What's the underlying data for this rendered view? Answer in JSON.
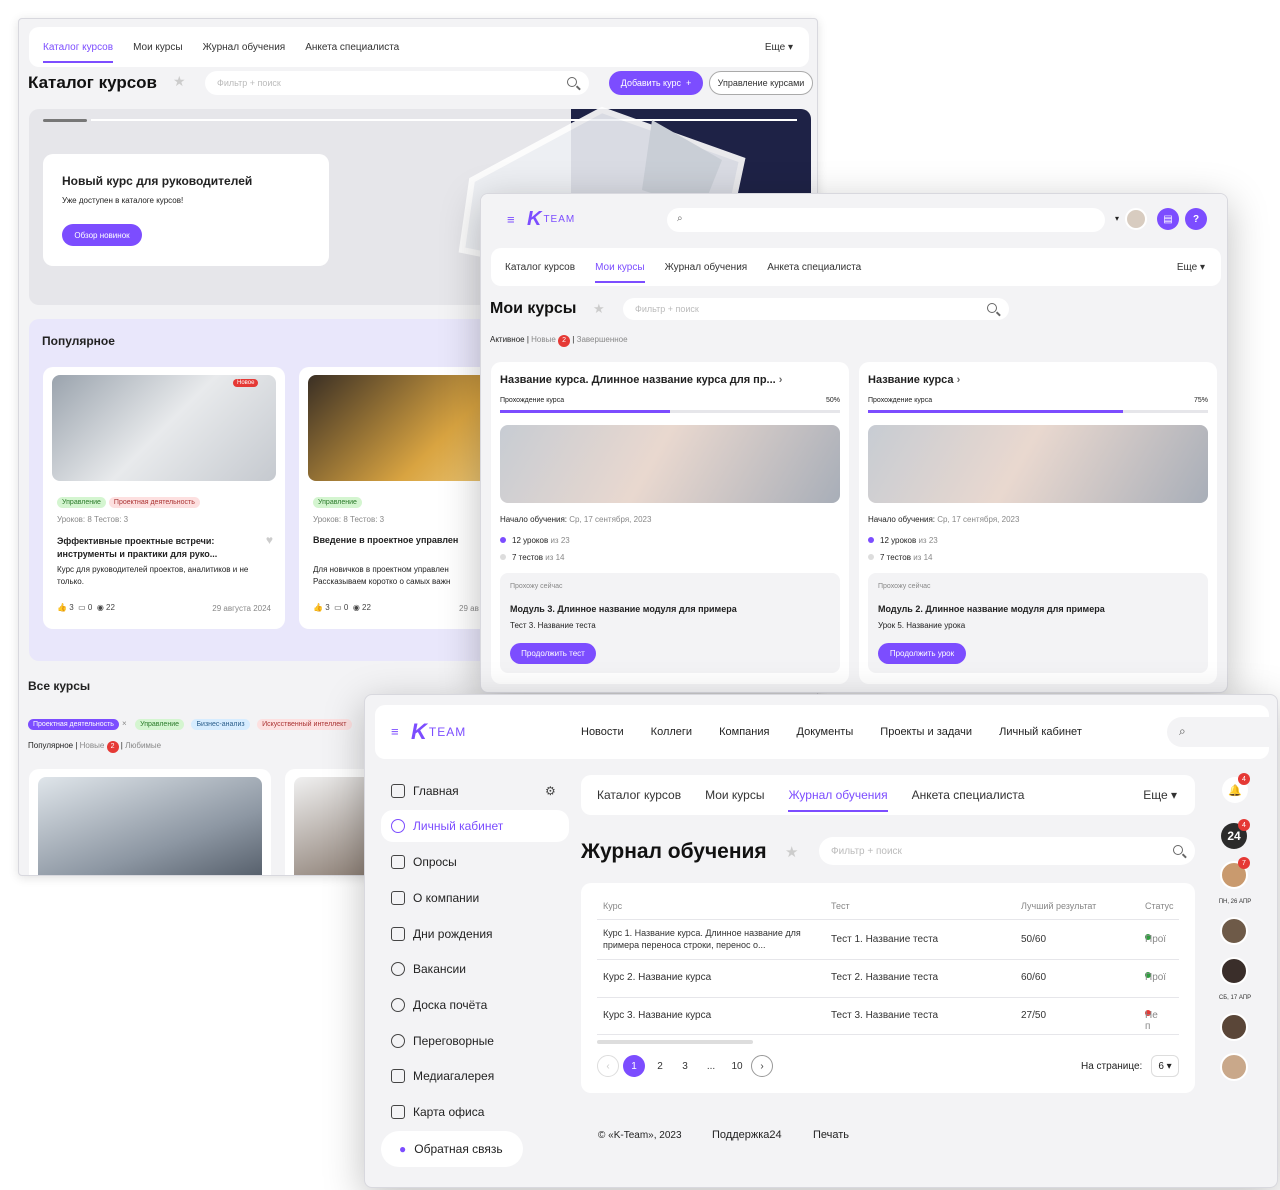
{
  "w1": {
    "tabs": [
      "Каталог курсов",
      "Мои курсы",
      "Журнал обучения",
      "Анкета специалиста"
    ],
    "more": "Еще",
    "title": "Каталог курсов",
    "search_placeholder": "Фильтр + поиск",
    "add_button": "Добавить курс",
    "manage_button": "Управление курсами",
    "banner": {
      "title": "Новый курс для руководителей",
      "text": "Уже доступен в каталоге курсов!",
      "button": "Обзор новинок"
    },
    "popular_title": "Популярное",
    "cards": [
      {
        "badge": "Новое",
        "tags": [
          "Управление",
          "Проектная деятельность"
        ],
        "meta": "Уроков: 8  Тестов: 3",
        "title": "Эффективные проектные встречи: инструменты и практики для руко...",
        "desc": "Курс для руководителей проектов, аналитиков и не только.",
        "likes": "3",
        "comments": "0",
        "views": "22",
        "date": "29 августа 2024"
      },
      {
        "tags": [
          "Управление"
        ],
        "meta": "Уроков: 8  Тестов: 3",
        "title": "Введение в проектное управлен",
        "desc": "Для новичков в проектном управлен Рассказываем коротко о самых важн",
        "likes": "3",
        "comments": "0",
        "views": "22",
        "date": "29 ав"
      }
    ],
    "all_title": "Все курсы",
    "filter_tags": [
      "Проектная деятельность",
      "Управление",
      "Бизнес-анализ",
      "Искусственный интеллект"
    ],
    "sort": [
      "Популярное",
      "Новые",
      "Любимые"
    ],
    "new_count": "2"
  },
  "w2": {
    "logo": "TEAM",
    "tabs": [
      "Каталог курсов",
      "Мои курсы",
      "Журнал обучения",
      "Анкета специалиста"
    ],
    "more": "Еще",
    "title": "Мои курсы",
    "search_placeholder": "Фильтр + поиск",
    "filters": [
      "Активное",
      "Новые",
      "Завершенное"
    ],
    "new_count": "2",
    "courses": [
      {
        "title": "Название курса. Длинное название курса для пр...",
        "progress_label": "Прохождение курса",
        "progress": "50%",
        "progress_value": 0.5,
        "start_label": "Начало обучения:",
        "start_date": "Ср, 17 сентября, 2023",
        "lessons": "12 уроков",
        "lessons_of": "из 23",
        "tests": "7 тестов",
        "tests_of": "из 14",
        "now_label": "Прохожу сейчас",
        "module": "Модуль 3. Длинное название модуля для примера",
        "sub": "Тест 3. Название теста",
        "button": "Продолжить тест"
      },
      {
        "title": "Название курса",
        "progress_label": "Прохождение курса",
        "progress": "75%",
        "progress_value": 0.75,
        "start_label": "Начало обучения:",
        "start_date": "Ср, 17 сентября, 2023",
        "lessons": "12 уроков",
        "lessons_of": "из 23",
        "tests": "7 тестов",
        "tests_of": "из 14",
        "now_label": "Прохожу сейчас",
        "module": "Модуль 2. Длинное название модуля для примера",
        "sub": "Урок 5. Название урока",
        "button": "Продолжить урок"
      }
    ]
  },
  "w3": {
    "logo": "TEAM",
    "topnav": [
      "Новости",
      "Коллеги",
      "Компания",
      "Документы",
      "Проекты и задачи",
      "Личный кабинет"
    ],
    "sidebar": [
      "Главная",
      "Личный кабинет",
      "Опросы",
      "О компании",
      "Дни рождения",
      "Вакансии",
      "Доска почёта",
      "Переговорные",
      "Медиагалерея",
      "Карта офиса"
    ],
    "feedback": "Обратная связь",
    "tabs": [
      "Каталог курсов",
      "Мои курсы",
      "Журнал обучения",
      "Анкета специалиста"
    ],
    "more": "Еще",
    "title": "Журнал обучения",
    "search_placeholder": "Фильтр + поиск",
    "columns": [
      "Курс",
      "Тест",
      "Лучший результат",
      "Статус"
    ],
    "rows": [
      {
        "course": "Курс 1. Название курса. Длинное название для примера переноса строки, перенос о...",
        "test": "Тест 1. Название теста",
        "result": "50/60",
        "status": "Прої",
        "color": "#2e9e3e"
      },
      {
        "course": "Курс 2. Название курса",
        "test": "Тест 2. Название теста",
        "result": "60/60",
        "status": "Прої",
        "color": "#2e9e3e"
      },
      {
        "course": "Курс 3. Название курса",
        "test": "Тест 3. Название теста",
        "result": "27/50",
        "status": "Не п",
        "color": "#e53935"
      }
    ],
    "pages": [
      "1",
      "2",
      "3",
      "...",
      "10"
    ],
    "per_page_label": "На странице:",
    "per_page": "6",
    "footer": [
      "© «K-Team», 2023",
      "Поддержка24",
      "Печать"
    ],
    "right": {
      "bell_badge": "4",
      "cal_number": "24",
      "cal_badge": "4",
      "avatar_badge": "7",
      "date1": "ПН, 26 АПР",
      "date2": "СБ, 17 АПР"
    }
  }
}
